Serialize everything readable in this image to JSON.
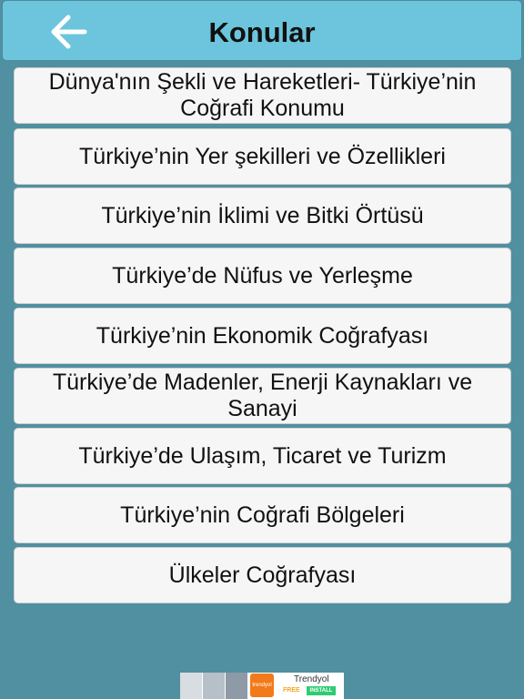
{
  "header": {
    "title": "Konular",
    "back_icon": "arrow-left-icon"
  },
  "topics": [
    "Dünya'nın Şekli ve Hareketleri- Türkiye’nin Coğrafi Konumu",
    "Türkiye’nin Yer şekilleri ve Özellikleri",
    "Türkiye’nin İklimi ve Bitki Örtüsü",
    "Türkiye’de Nüfus ve Yerleşme",
    "Türkiye’nin Ekonomik Coğrafyası",
    "Türkiye’de Madenler, Enerji Kaynakları ve Sanayi",
    "Türkiye’de Ulaşım, Ticaret ve Turizm",
    "Türkiye’nin Coğrafi Bölgeleri",
    "Ülkeler Coğrafyası"
  ],
  "ad": {
    "logo_text": "trendyol",
    "name": "Trendyol",
    "free": "FREE",
    "install": "INSTALL"
  },
  "colors": {
    "background": "#5090a0",
    "header": "#6cc5dc",
    "topic_bg": "#f6f6f6",
    "ad_orange": "#f27a1a",
    "ad_green": "#2ecc71"
  }
}
